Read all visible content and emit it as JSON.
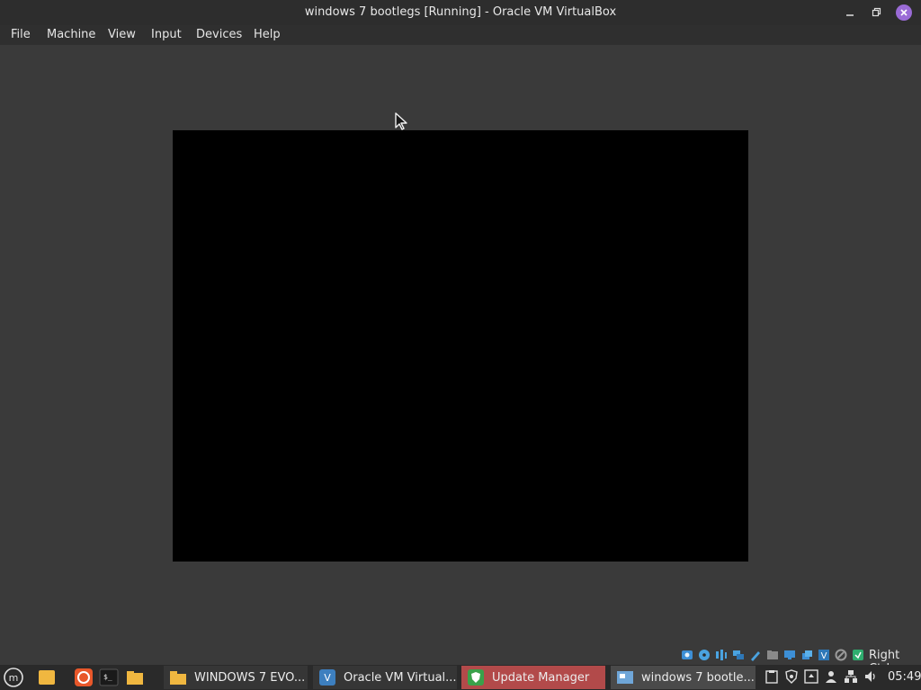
{
  "window": {
    "title": "windows 7 bootlegs [Running] - Oracle VM VirtualBox"
  },
  "menu": {
    "items": [
      {
        "label": "File"
      },
      {
        "label": "Machine"
      },
      {
        "label": "View"
      },
      {
        "label": "Input"
      },
      {
        "label": "Devices"
      },
      {
        "label": "Help"
      }
    ]
  },
  "status_bar": {
    "icons": [
      "hard-disk-icon",
      "optical-drive-icon",
      "audio-icon",
      "network-icon",
      "usb-icon",
      "shared-folders-icon",
      "display-icon",
      "recording-icon",
      "vt-x-icon",
      "mouse-integration-icon",
      "keyboard-icon"
    ],
    "host_key": "Right Ctrl"
  },
  "taskbar": {
    "launchers": [
      "mint-menu-icon",
      "files-icon",
      "firefox-icon",
      "terminal-icon",
      "folder-icon"
    ],
    "tasks": [
      {
        "label": "WINDOWS 7 EVO...",
        "icon": "folder-icon"
      },
      {
        "label": "Oracle VM Virtual...",
        "icon": "virtualbox-icon"
      },
      {
        "label": "Update Manager",
        "icon": "shield-icon"
      },
      {
        "label": "windows 7 bootle...",
        "icon": "vm-window-icon"
      }
    ],
    "tray_icons": [
      "clipboard-icon",
      "update-shield-icon",
      "eject-icon",
      "user-icon",
      "network-icon",
      "volume-icon"
    ],
    "clock": "05:49"
  },
  "colors": {
    "titlebar": "#2d2d2d",
    "background": "#3a3a3a",
    "vm_screen": "#000000",
    "close_button": "#9a6bd6",
    "update_manager_task": "#b24a4a",
    "active_task": "#4a4a4a"
  }
}
